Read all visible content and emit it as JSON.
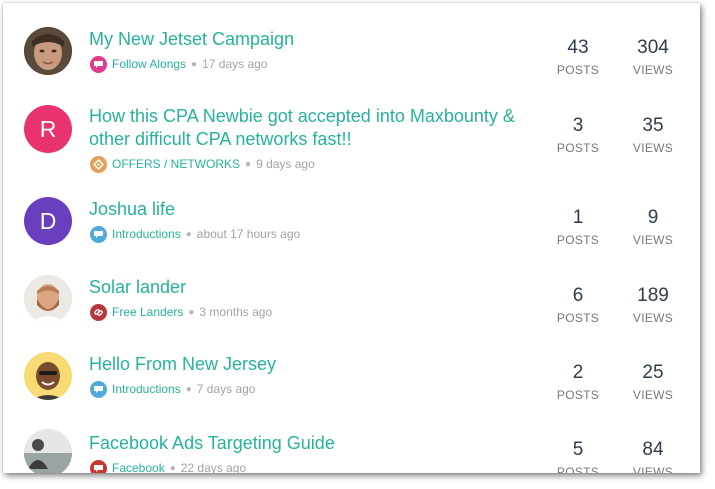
{
  "topics": [
    {
      "title": "My New Jetset Campaign",
      "category": "Follow Alongs",
      "category_color": "#e03a8c",
      "category_icon": "chat-bubble-icon",
      "time": "17 days ago",
      "posts": "43",
      "views": "304",
      "posts_label": "POSTS",
      "views_label": "VIEWS",
      "avatar": {
        "type": "photo",
        "bg": "#6b5a4a"
      }
    },
    {
      "title": "How this CPA Newbie got accepted into Maxbounty & other difficult CPA networks fast!!",
      "category": "OFFERS / NETWORKS",
      "category_color": "#e4a05a",
      "category_icon": "diamond-tag-icon",
      "time": "9 days ago",
      "posts": "3",
      "views": "35",
      "posts_label": "POSTS",
      "views_label": "VIEWS",
      "avatar": {
        "type": "letter",
        "letter": "R",
        "bg": "#e8336d"
      }
    },
    {
      "title": "Joshua life",
      "category": "Introductions",
      "category_color": "#4faadb",
      "category_icon": "chat-bubble-icon",
      "time": "about 17 hours ago",
      "posts": "1",
      "views": "9",
      "posts_label": "POSTS",
      "views_label": "VIEWS",
      "avatar": {
        "type": "letter",
        "letter": "D",
        "bg": "#6a3fbf"
      }
    },
    {
      "title": "Solar lander",
      "category": "Free Landers",
      "category_color": "#b8373c",
      "category_icon": "link-icon",
      "time": "3 months ago",
      "posts": "6",
      "views": "189",
      "posts_label": "POSTS",
      "views_label": "VIEWS",
      "avatar": {
        "type": "photo",
        "bg": "#e8e3dd"
      }
    },
    {
      "title": "Hello From New Jersey",
      "category": "Introductions",
      "category_color": "#4faadb",
      "category_icon": "chat-bubble-icon",
      "time": "7 days ago",
      "posts": "2",
      "views": "25",
      "posts_label": "POSTS",
      "views_label": "VIEWS",
      "avatar": {
        "type": "photo",
        "bg": "#f6d56a"
      }
    },
    {
      "title": "Facebook Ads Targeting Guide",
      "category": "Facebook",
      "category_color": "#c8372e",
      "category_icon": "chat-bubble-icon",
      "time": "22 days ago",
      "posts": "5",
      "views": "84",
      "posts_label": "POSTS",
      "views_label": "VIEWS",
      "avatar": {
        "type": "photo",
        "bg": "#d9d9d9"
      }
    }
  ]
}
